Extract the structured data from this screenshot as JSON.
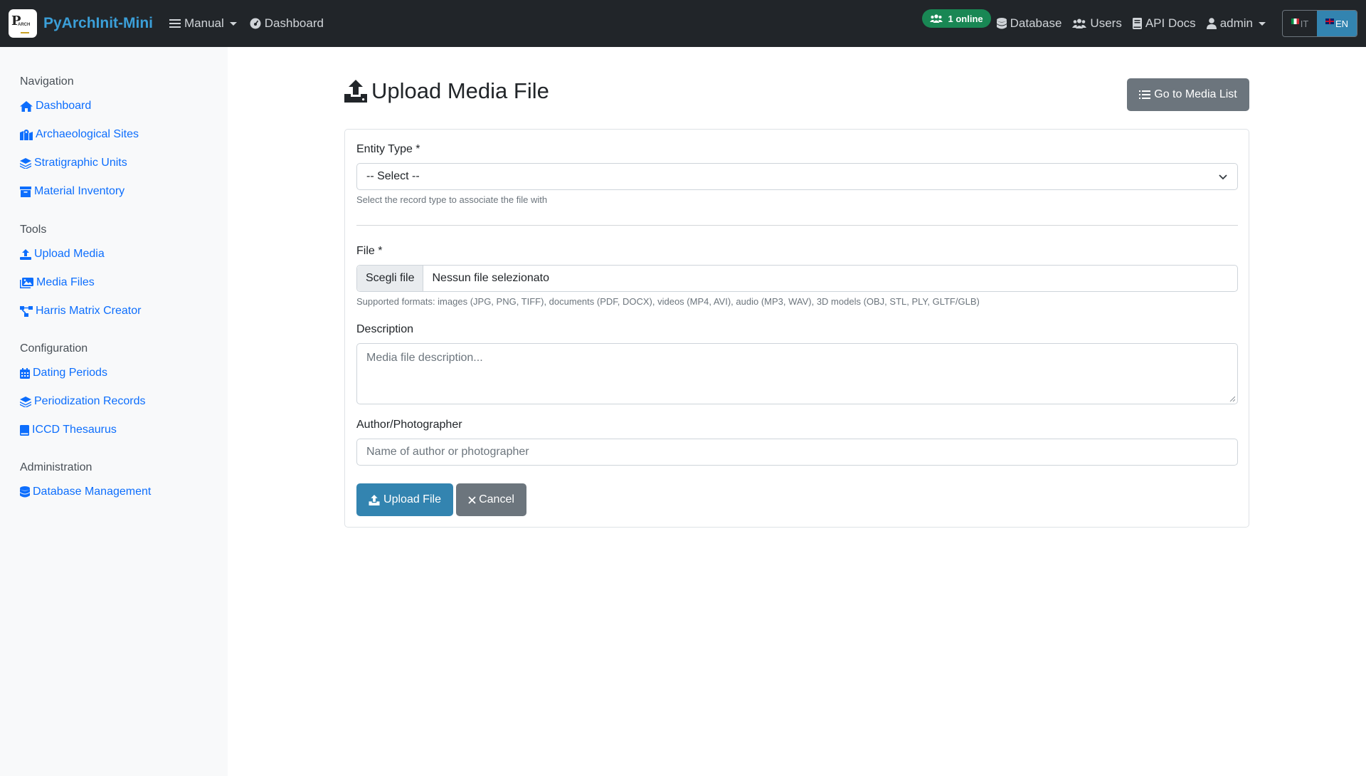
{
  "navbar": {
    "brand": "PyArchInit-Mini",
    "manual": "Manual",
    "dashboard": "Dashboard",
    "online_badge": "1 online",
    "database": "Database",
    "users": "Users",
    "api_docs": "API Docs",
    "user": "admin",
    "lang_it": "IT",
    "lang_en": "EN"
  },
  "sidebar": {
    "navigation_title": "Navigation",
    "navigation": [
      "Dashboard",
      "Archaeological Sites",
      "Stratigraphic Units",
      "Material Inventory"
    ],
    "tools_title": "Tools",
    "tools": [
      "Upload Media",
      "Media Files",
      "Harris Matrix Creator"
    ],
    "configuration_title": "Configuration",
    "configuration": [
      "Dating Periods",
      "Periodization Records",
      "ICCD Thesaurus"
    ],
    "administration_title": "Administration",
    "administration": [
      "Database Management"
    ]
  },
  "main": {
    "title": "Upload Media File",
    "media_list_button": "Go to Media List"
  },
  "form": {
    "entity_type_label": "Entity Type *",
    "entity_type_value": "-- Select --",
    "entity_type_help": "Select the record type to associate the file with",
    "file_label": "File *",
    "file_button": "Scegli file",
    "file_name": "Nessun file selezionato",
    "file_help": "Supported formats: images (JPG, PNG, TIFF), documents (PDF, DOCX), videos (MP4, AVI), audio (MP3, WAV), 3D models (OBJ, STL, PLY, GLTF/GLB)",
    "description_label": "Description",
    "description_placeholder": "Media file description...",
    "author_label": "Author/Photographer",
    "author_placeholder": "Name of author or photographer",
    "upload_button": "Upload File",
    "cancel_button": "Cancel"
  },
  "colors": {
    "navbar_bg": "#212529",
    "brand": "#3b9fd8",
    "link": "#0d6efd",
    "primary_button": "#3384b0",
    "secondary_button": "#6c757d",
    "online_badge": "#198754"
  }
}
